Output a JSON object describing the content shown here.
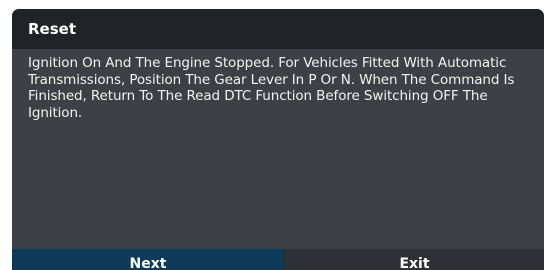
{
  "dialog": {
    "title": "Reset",
    "message": "Ignition On And The Engine Stopped. For Vehicles Fitted With Automatic Transmissions, Position The Gear Lever In P Or N. When The Command Is Finished, Return To The Read DTC Function Before Switching OFF The Ignition.",
    "buttons": {
      "next_label": "Next",
      "exit_label": "Exit"
    }
  },
  "colors": {
    "header_bg": "#212426",
    "body_bg": "#3d4145",
    "next_button_bg": "#0c3a58",
    "exit_button_bg": "#2d3034",
    "text": "#ffffff"
  }
}
